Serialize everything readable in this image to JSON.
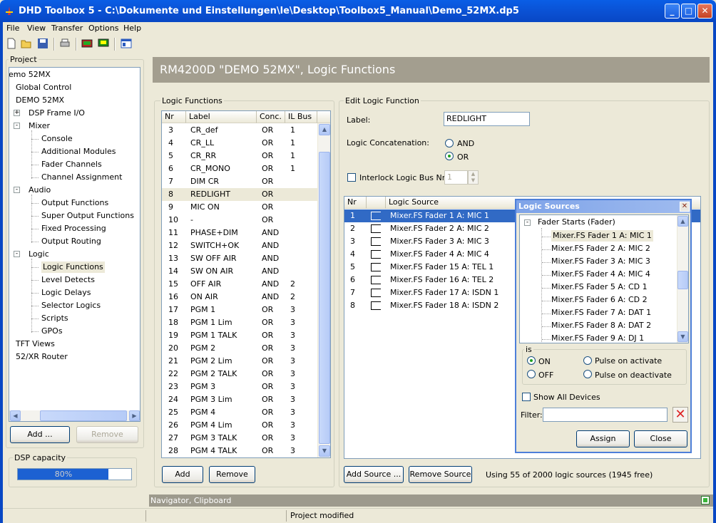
{
  "window": {
    "title": "DHD Toolbox 5 - C:\\Dokumente und Einstellungen\\le\\Desktop\\Toolbox5_Manual\\Demo_52MX.dp5",
    "min_icon": "minimize-icon",
    "max_icon": "maximize-icon",
    "close_icon": "close-icon"
  },
  "menu": [
    "File",
    "View",
    "Transfer",
    "Options",
    "Help"
  ],
  "toolbar": {
    "icons": [
      "new-file-icon",
      "open-folder-icon",
      "save-icon",
      "print-icon",
      "device-icon",
      "monitor-icon",
      "window-icon"
    ]
  },
  "project": {
    "label": "Project",
    "tree": [
      {
        "text": "emo 52MX",
        "level": 0
      },
      {
        "text": "Global Control",
        "level": 1
      },
      {
        "text": "DEMO 52MX",
        "level": 1
      },
      {
        "text": "DSP Frame I/O",
        "level": 1,
        "toggle": "+"
      },
      {
        "text": "Mixer",
        "level": 1,
        "toggle": "-"
      },
      {
        "text": "Console",
        "level": 2
      },
      {
        "text": "Additional Modules",
        "level": 2
      },
      {
        "text": "Fader Channels",
        "level": 2
      },
      {
        "text": "Channel Assignment",
        "level": 2
      },
      {
        "text": "Audio",
        "level": 1,
        "toggle": "-"
      },
      {
        "text": "Output Functions",
        "level": 2
      },
      {
        "text": "Super Output Functions",
        "level": 2
      },
      {
        "text": "Fixed Processing",
        "level": 2
      },
      {
        "text": "Output Routing",
        "level": 2
      },
      {
        "text": "Logic",
        "level": 1,
        "toggle": "-"
      },
      {
        "text": "Logic Functions",
        "level": 2,
        "selected": true
      },
      {
        "text": "Level Detects",
        "level": 2
      },
      {
        "text": "Logic Delays",
        "level": 2
      },
      {
        "text": "Selector Logics",
        "level": 2
      },
      {
        "text": "Scripts",
        "level": 2
      },
      {
        "text": "GPOs",
        "level": 2
      },
      {
        "text": "TFT Views",
        "level": 1
      },
      {
        "text": "52/XR Router",
        "level": 0
      }
    ],
    "add_button": "Add ...",
    "remove_button": "Remove"
  },
  "dsp": {
    "label": "DSP capacity",
    "percent_text": "80%",
    "percent": 80
  },
  "header": {
    "title": "RM4200D \"DEMO 52MX\", Logic Functions"
  },
  "logic_functions": {
    "label": "Logic Functions",
    "columns": [
      "Nr",
      "Label",
      "Conc.",
      "IL Bus"
    ],
    "rows": [
      [
        "3",
        "CR_def",
        "OR",
        "1"
      ],
      [
        "4",
        "CR_LL",
        "OR",
        "1"
      ],
      [
        "5",
        "CR_RR",
        "OR",
        "1"
      ],
      [
        "6",
        "CR_MONO",
        "OR",
        "1"
      ],
      [
        "7",
        "DIM CR",
        "OR",
        ""
      ],
      [
        "8",
        "REDLIGHT",
        "OR",
        ""
      ],
      [
        "9",
        "MIC ON",
        "OR",
        ""
      ],
      [
        "10",
        "-",
        "OR",
        ""
      ],
      [
        "11",
        "PHASE+DIM",
        "AND",
        ""
      ],
      [
        "12",
        "SWITCH+OK",
        "AND",
        ""
      ],
      [
        "13",
        "SW OFF AIR",
        "AND",
        ""
      ],
      [
        "14",
        "SW ON AIR",
        "AND",
        ""
      ],
      [
        "15",
        "OFF AIR",
        "AND",
        "2"
      ],
      [
        "16",
        "ON AIR",
        "AND",
        "2"
      ],
      [
        "17",
        "PGM 1",
        "OR",
        "3"
      ],
      [
        "18",
        "PGM 1 Lim",
        "OR",
        "3"
      ],
      [
        "19",
        "PGM 1 TALK",
        "OR",
        "3"
      ],
      [
        "20",
        "PGM 2",
        "OR",
        "3"
      ],
      [
        "21",
        "PGM 2 Lim",
        "OR",
        "3"
      ],
      [
        "22",
        "PGM 2 TALK",
        "OR",
        "3"
      ],
      [
        "23",
        "PGM 3",
        "OR",
        "3"
      ],
      [
        "24",
        "PGM 3 Lim",
        "OR",
        "3"
      ],
      [
        "25",
        "PGM 4",
        "OR",
        "3"
      ],
      [
        "26",
        "PGM 4 Lim",
        "OR",
        "3"
      ],
      [
        "27",
        "PGM 3 TALK",
        "OR",
        "3"
      ],
      [
        "28",
        "PGM 4 TALK",
        "OR",
        "3"
      ]
    ],
    "selected_index": 5,
    "add_button": "Add",
    "remove_button": "Remove"
  },
  "edit": {
    "label": "Edit Logic Function",
    "label_field_label": "Label:",
    "label_value": "REDLIGHT",
    "concat_label": "Logic Concatenation:",
    "concat_and": "AND",
    "concat_or": "OR",
    "concat_selected": "OR",
    "interlock_label": "Interlock Logic Bus Nr:",
    "interlock_value": "1",
    "columns": [
      "Nr",
      "",
      "Logic Source"
    ],
    "sources": [
      [
        "1",
        "Mixer.FS Fader 1 A: MIC 1"
      ],
      [
        "2",
        "Mixer.FS Fader 2 A: MIC 2"
      ],
      [
        "3",
        "Mixer.FS Fader 3 A: MIC 3"
      ],
      [
        "4",
        "Mixer.FS Fader 4 A: MIC 4"
      ],
      [
        "5",
        "Mixer.FS Fader 15 A: TEL 1"
      ],
      [
        "6",
        "Mixer.FS Fader 16 A: TEL 2"
      ],
      [
        "7",
        "Mixer.FS Fader 17 A: ISDN 1"
      ],
      [
        "8",
        "Mixer.FS Fader 18 A: ISDN 2"
      ]
    ],
    "add_source_button": "Add Source ...",
    "remove_source_button": "Remove Source",
    "usage_text": "Using 55 of 2000 logic sources (1945 free)"
  },
  "dialog": {
    "title": "Logic Sources",
    "group": "Fader Starts (Fader)",
    "items": [
      "Mixer.FS Fader 1 A: MIC 1",
      "Mixer.FS Fader 2 A: MIC 2",
      "Mixer.FS Fader 3 A: MIC 3",
      "Mixer.FS Fader 4 A: MIC 4",
      "Mixer.FS Fader 5 A: CD 1",
      "Mixer.FS Fader 6 A: CD 2",
      "Mixer.FS Fader 7 A: DAT 1",
      "Mixer.FS Fader 8 A: DAT 2",
      "Mixer.FS Fader 9 A: DJ 1"
    ],
    "is_label": "is",
    "on": "ON",
    "off": "OFF",
    "pulse_activate": "Pulse on activate",
    "pulse_deactivate": "Pulse on deactivate",
    "show_all": "Show All Devices",
    "filter_label": "Filter:",
    "filter_value": "",
    "assign": "Assign",
    "close": "Close"
  },
  "navigator": {
    "label": "Navigator, Clipboard"
  },
  "status": {
    "text": "Project modified"
  }
}
